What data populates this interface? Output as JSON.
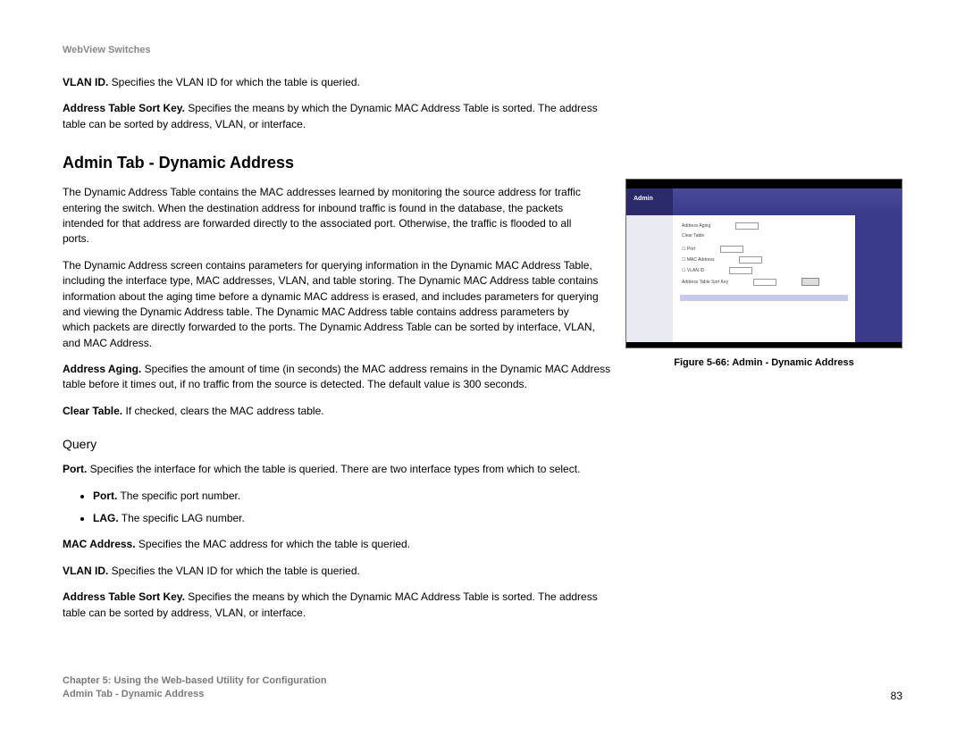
{
  "header": {
    "title": "WebView Switches"
  },
  "intro": {
    "vlan_id_label": "VLAN ID.",
    "vlan_id_text": " Specifies the VLAN ID for which the table is queried.",
    "sort_key_label": "Address Table Sort Key.",
    "sort_key_text": " Specifies the means by which the Dynamic MAC Address Table is sorted. The address table can be sorted by address, VLAN, or interface."
  },
  "section": {
    "heading": "Admin Tab - Dynamic Address",
    "p1": "The Dynamic Address Table contains the MAC addresses learned by monitoring the source address for traffic entering the switch. When the destination address for inbound traffic is found in the database, the packets intended for that address are forwarded directly to the associated port. Otherwise, the traffic is flooded to all ports.",
    "p2": "The Dynamic Address screen contains parameters for querying information in the Dynamic MAC Address Table, including the interface type, MAC addresses, VLAN, and table storing. The Dynamic MAC Address table contains information about the aging time before a dynamic MAC address is erased, and includes parameters for querying and viewing the Dynamic Address table. The Dynamic MAC Address table contains address parameters by which packets are directly forwarded to the ports. The Dynamic Address Table can be sorted by interface, VLAN, and MAC Address.",
    "aging_label": "Address Aging.",
    "aging_text": " Specifies the amount of time (in seconds) the MAC address remains in the Dynamic MAC Address table before it times out, if no traffic from the source is detected. The default value is 300 seconds.",
    "clear_label": "Clear Table.",
    "clear_text": " If checked, clears the MAC address table."
  },
  "query": {
    "heading": "Query",
    "port_label": "Port.",
    "port_text": " Specifies the interface for which the table is queried. There are two interface types from which to select.",
    "bullets": {
      "port_label": "Port.",
      "port_text": " The specific port number.",
      "lag_label": "LAG.",
      "lag_text": " The specific LAG number."
    },
    "mac_label": "MAC Address.",
    "mac_text": " Specifies the MAC address for which the table is queried.",
    "vlan_label": "VLAN ID.",
    "vlan_text": " Specifies the VLAN ID for which the table is queried.",
    "sort_label": "Address Table Sort Key.",
    "sort_text": " Specifies the means by which the Dynamic MAC Address Table is sorted. The address table can be sorted by address, VLAN, or interface."
  },
  "figure": {
    "tab_label": "Admin",
    "caption": "Figure 5-66: Admin - Dynamic Address"
  },
  "footer": {
    "chapter": "Chapter 5: Using the Web-based Utility for Configuration",
    "section": "Admin Tab - Dynamic Address",
    "page_number": "83"
  }
}
